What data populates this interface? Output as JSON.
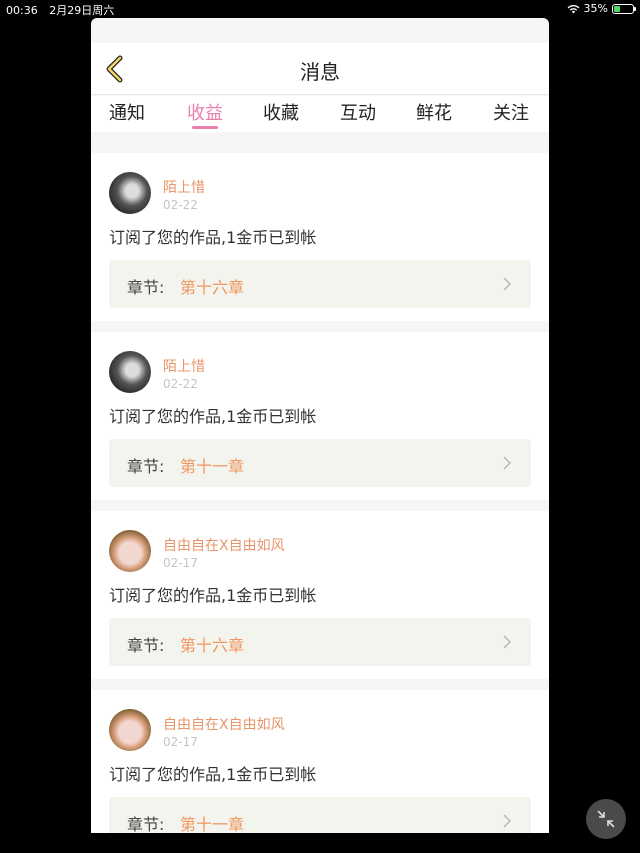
{
  "status": {
    "time": "00:36",
    "date": "2月29日周六",
    "battery": "35%",
    "battery_level": 0.35
  },
  "header": {
    "title": "消息"
  },
  "tabs": [
    {
      "label": "通知",
      "active": false
    },
    {
      "label": "收益",
      "active": true
    },
    {
      "label": "收藏",
      "active": false
    },
    {
      "label": "互动",
      "active": false
    },
    {
      "label": "鲜花",
      "active": false
    },
    {
      "label": "关注",
      "active": false
    }
  ],
  "items": [
    {
      "name": "陌上惜",
      "date": "02-22",
      "message": "订阅了您的作品,1金币已到帐",
      "chapter_label": "章节:",
      "chapter": "第十六章",
      "avatar": "dark-photo-avatar"
    },
    {
      "name": "陌上惜",
      "date": "02-22",
      "message": "订阅了您的作品,1金币已到帐",
      "chapter_label": "章节:",
      "chapter": "第十一章",
      "avatar": "dark-photo-avatar"
    },
    {
      "name": "自由自在X自由如风",
      "date": "02-17",
      "message": "订阅了您的作品,1金币已到帐",
      "chapter_label": "章节:",
      "chapter": "第十六章",
      "avatar": "doraemon-avatar"
    },
    {
      "name": "自由自在X自由如风",
      "date": "02-17",
      "message": "订阅了您的作品,1金币已到帐",
      "chapter_label": "章节:",
      "chapter": "第十一章",
      "avatar": "doraemon-avatar"
    }
  ],
  "colors": {
    "accent_tab": "#e87fae",
    "username": "#e8956a",
    "chapter": "#f0965f"
  }
}
